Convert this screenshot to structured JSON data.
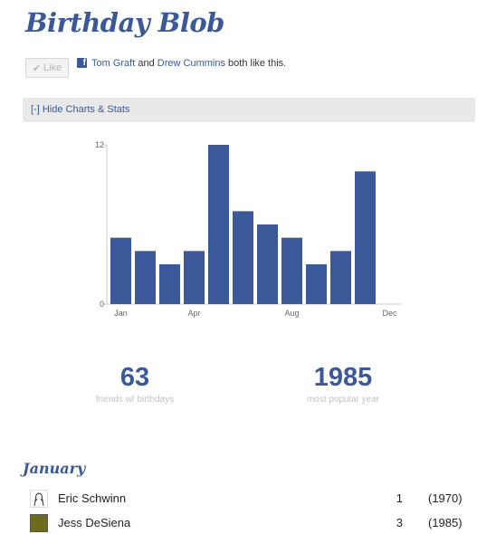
{
  "app": {
    "title": "Birthday Blob"
  },
  "like": {
    "button_label": "Like",
    "friend1": "Tom Graft",
    "joiner": "and",
    "friend2": "Drew Cummins",
    "suffix": "both like this."
  },
  "toggle": {
    "label": "[-] Hide Charts & Stats"
  },
  "chart_data": {
    "type": "bar",
    "categories": [
      "Jan",
      "Feb",
      "Mar",
      "Apr",
      "May",
      "Jun",
      "Jul",
      "Aug",
      "Sep",
      "Oct",
      "Nov",
      "Dec"
    ],
    "values": [
      5,
      4,
      3,
      4,
      12,
      7,
      6,
      5,
      3,
      4,
      10,
      0
    ],
    "tick_labels": [
      "Jan",
      "Apr",
      "Aug",
      "Dec"
    ],
    "ylim": [
      0,
      12
    ],
    "yticks": [
      0,
      12
    ],
    "color": "#3b5998"
  },
  "stats": {
    "friends_count": "63",
    "friends_label": "friends w/ birthdays",
    "popular_year": "1985",
    "popular_year_label": "most popular year"
  },
  "month": {
    "name": "January",
    "people": [
      {
        "name": "Eric Schwinn",
        "day": "1",
        "year": "(1970)"
      },
      {
        "name": "Jess DeSiena",
        "day": "3",
        "year": "(1985)"
      }
    ]
  }
}
